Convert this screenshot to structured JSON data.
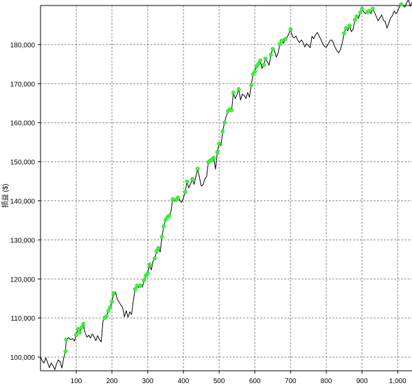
{
  "chart_data": {
    "type": "line",
    "title": "",
    "xlabel": "",
    "ylabel": "损益 ($)",
    "xlim": [
      0,
      1040
    ],
    "ylim": [
      96500,
      190000
    ],
    "x_ticks": [
      100,
      200,
      300,
      400,
      500,
      600,
      700,
      800,
      900,
      1000
    ],
    "x_tick_labels": [
      "100",
      "200",
      "300",
      "400",
      "500",
      "600",
      "700",
      "800",
      "900",
      "1,000"
    ],
    "y_ticks": [
      100000,
      110000,
      120000,
      130000,
      140000,
      150000,
      160000,
      170000,
      180000
    ],
    "y_tick_labels": [
      "100,000",
      "110,000",
      "120,000",
      "130,000",
      "140,000",
      "150,000",
      "160,000",
      "170,000",
      "180,000"
    ],
    "grid": true,
    "legend": "none",
    "colors": {
      "line": "#000000",
      "marker": "#33ff33",
      "grid": "#8c8c8c",
      "axis": "#000000"
    },
    "series": [
      {
        "values": [
          [
            0,
            100000
          ],
          [
            5,
            99000
          ],
          [
            10,
            98500
          ],
          [
            15,
            99800
          ],
          [
            20,
            98500
          ],
          [
            25,
            97300
          ],
          [
            30,
            98500
          ],
          [
            35,
            97800
          ],
          [
            40,
            96800
          ],
          [
            45,
            98300
          ],
          [
            50,
            99300
          ],
          [
            55,
            98800
          ],
          [
            60,
            97200
          ],
          [
            65,
            99800
          ],
          [
            70,
            101500
          ],
          [
            72,
            104500
          ],
          [
            78,
            105000
          ],
          [
            84,
            104500
          ],
          [
            90,
            104700
          ],
          [
            95,
            104100
          ],
          [
            100,
            105700
          ],
          [
            105,
            107200
          ],
          [
            110,
            106300
          ],
          [
            115,
            107500
          ],
          [
            120,
            108500
          ],
          [
            125,
            106200
          ],
          [
            130,
            105100
          ],
          [
            135,
            105600
          ],
          [
            140,
            104900
          ],
          [
            145,
            105900
          ],
          [
            150,
            105200
          ],
          [
            155,
            104200
          ],
          [
            160,
            105500
          ],
          [
            165,
            104500
          ],
          [
            170,
            103900
          ],
          [
            175,
            109200
          ],
          [
            180,
            110100
          ],
          [
            185,
            110500
          ],
          [
            190,
            111900
          ],
          [
            195,
            112800
          ],
          [
            200,
            114200
          ],
          [
            205,
            116300
          ],
          [
            210,
            116700
          ],
          [
            215,
            114800
          ],
          [
            220,
            114100
          ],
          [
            225,
            113300
          ],
          [
            230,
            112700
          ],
          [
            235,
            110300
          ],
          [
            240,
            111900
          ],
          [
            245,
            110200
          ],
          [
            250,
            111600
          ],
          [
            255,
            110900
          ],
          [
            260,
            114700
          ],
          [
            265,
            117400
          ],
          [
            270,
            118300
          ],
          [
            275,
            117800
          ],
          [
            280,
            118300
          ],
          [
            285,
            117900
          ],
          [
            290,
            119700
          ],
          [
            295,
            120900
          ],
          [
            300,
            121400
          ],
          [
            305,
            123700
          ],
          [
            310,
            122300
          ],
          [
            315,
            124600
          ],
          [
            320,
            125300
          ],
          [
            325,
            127100
          ],
          [
            330,
            127900
          ],
          [
            335,
            126900
          ],
          [
            340,
            130800
          ],
          [
            345,
            133500
          ],
          [
            350,
            135100
          ],
          [
            355,
            135800
          ],
          [
            360,
            136200
          ],
          [
            365,
            137200
          ],
          [
            370,
            140400
          ],
          [
            375,
            139900
          ],
          [
            380,
            140300
          ],
          [
            385,
            140800
          ],
          [
            390,
            140200
          ],
          [
            395,
            139600
          ],
          [
            400,
            140700
          ],
          [
            405,
            142300
          ],
          [
            410,
            144900
          ],
          [
            415,
            143300
          ],
          [
            420,
            144300
          ],
          [
            425,
            145600
          ],
          [
            430,
            144200
          ],
          [
            435,
            146300
          ],
          [
            440,
            148200
          ],
          [
            445,
            145900
          ],
          [
            450,
            143800
          ],
          [
            455,
            144100
          ],
          [
            460,
            145600
          ],
          [
            465,
            146200
          ],
          [
            470,
            149900
          ],
          [
            475,
            150300
          ],
          [
            480,
            150600
          ],
          [
            485,
            151000
          ],
          [
            490,
            148100
          ],
          [
            495,
            152500
          ],
          [
            500,
            154600
          ],
          [
            505,
            154100
          ],
          [
            510,
            157800
          ],
          [
            515,
            160000
          ],
          [
            520,
            161700
          ],
          [
            525,
            163000
          ],
          [
            530,
            163400
          ],
          [
            535,
            163200
          ],
          [
            540,
            167700
          ],
          [
            545,
            166200
          ],
          [
            550,
            167200
          ],
          [
            555,
            168600
          ],
          [
            560,
            165800
          ],
          [
            565,
            167300
          ],
          [
            570,
            167000
          ],
          [
            575,
            166200
          ],
          [
            580,
            167700
          ],
          [
            585,
            166500
          ],
          [
            590,
            169700
          ],
          [
            595,
            172400
          ],
          [
            600,
            173100
          ],
          [
            605,
            174400
          ],
          [
            610,
            175100
          ],
          [
            615,
            175900
          ],
          [
            620,
            173900
          ],
          [
            625,
            174800
          ],
          [
            630,
            176400
          ],
          [
            635,
            175600
          ],
          [
            640,
            174700
          ],
          [
            645,
            177400
          ],
          [
            650,
            178900
          ],
          [
            655,
            178400
          ],
          [
            660,
            176800
          ],
          [
            665,
            177700
          ],
          [
            670,
            180100
          ],
          [
            675,
            181000
          ],
          [
            680,
            180300
          ],
          [
            685,
            181400
          ],
          [
            690,
            181800
          ],
          [
            695,
            182700
          ],
          [
            700,
            183900
          ],
          [
            705,
            182100
          ],
          [
            710,
            181700
          ],
          [
            715,
            182200
          ],
          [
            720,
            181100
          ],
          [
            725,
            180500
          ],
          [
            730,
            181200
          ],
          [
            735,
            180600
          ],
          [
            740,
            179400
          ],
          [
            745,
            180200
          ],
          [
            750,
            179800
          ],
          [
            755,
            179200
          ],
          [
            760,
            182100
          ],
          [
            765,
            181500
          ],
          [
            770,
            182500
          ],
          [
            775,
            183100
          ],
          [
            780,
            182200
          ],
          [
            785,
            181300
          ],
          [
            790,
            180200
          ],
          [
            795,
            179500
          ],
          [
            800,
            179300
          ],
          [
            805,
            180100
          ],
          [
            810,
            181000
          ],
          [
            815,
            181200
          ],
          [
            820,
            180400
          ],
          [
            825,
            179200
          ],
          [
            830,
            178400
          ],
          [
            835,
            177900
          ],
          [
            840,
            178800
          ],
          [
            845,
            180600
          ],
          [
            850,
            182900
          ],
          [
            855,
            184200
          ],
          [
            860,
            183500
          ],
          [
            865,
            184900
          ],
          [
            870,
            183300
          ],
          [
            875,
            183900
          ],
          [
            880,
            186300
          ],
          [
            885,
            187200
          ],
          [
            890,
            186700
          ],
          [
            895,
            188200
          ],
          [
            900,
            189200
          ],
          [
            905,
            188300
          ],
          [
            910,
            187900
          ],
          [
            915,
            188300
          ],
          [
            920,
            188600
          ],
          [
            925,
            187900
          ],
          [
            930,
            189200
          ],
          [
            935,
            188200
          ],
          [
            940,
            187200
          ],
          [
            945,
            186100
          ],
          [
            950,
            186800
          ],
          [
            955,
            187600
          ],
          [
            960,
            186300
          ],
          [
            965,
            185800
          ],
          [
            970,
            184200
          ],
          [
            975,
            185500
          ],
          [
            980,
            186800
          ],
          [
            985,
            187400
          ],
          [
            990,
            188600
          ],
          [
            995,
            187900
          ],
          [
            1000,
            188600
          ],
          [
            1005,
            189700
          ],
          [
            1010,
            190300
          ],
          [
            1015,
            190000
          ],
          [
            1020,
            189600
          ],
          [
            1025,
            190700
          ],
          [
            1030,
            191500
          ],
          [
            1035,
            189800
          ],
          [
            1040,
            190800
          ]
        ]
      }
    ],
    "highlight_markers": [
      [
        70,
        101500
      ],
      [
        72,
        104500
      ],
      [
        100,
        105700
      ],
      [
        105,
        107200
      ],
      [
        110,
        106300
      ],
      [
        115,
        107500
      ],
      [
        120,
        108500
      ],
      [
        180,
        110100
      ],
      [
        185,
        110500
      ],
      [
        190,
        111900
      ],
      [
        195,
        112800
      ],
      [
        200,
        114200
      ],
      [
        205,
        116300
      ],
      [
        265,
        117400
      ],
      [
        270,
        118300
      ],
      [
        280,
        118300
      ],
      [
        290,
        119700
      ],
      [
        295,
        120900
      ],
      [
        300,
        121400
      ],
      [
        305,
        123700
      ],
      [
        320,
        125300
      ],
      [
        325,
        127100
      ],
      [
        330,
        127900
      ],
      [
        340,
        130800
      ],
      [
        345,
        133500
      ],
      [
        350,
        135100
      ],
      [
        355,
        135800
      ],
      [
        360,
        136200
      ],
      [
        370,
        140400
      ],
      [
        380,
        140300
      ],
      [
        385,
        140800
      ],
      [
        405,
        142300
      ],
      [
        410,
        144900
      ],
      [
        425,
        145600
      ],
      [
        440,
        148200
      ],
      [
        470,
        149900
      ],
      [
        475,
        150300
      ],
      [
        480,
        150600
      ],
      [
        485,
        151000
      ],
      [
        495,
        152500
      ],
      [
        500,
        154600
      ],
      [
        510,
        157800
      ],
      [
        515,
        160000
      ],
      [
        525,
        163000
      ],
      [
        530,
        163400
      ],
      [
        535,
        163200
      ],
      [
        540,
        167700
      ],
      [
        555,
        168600
      ],
      [
        590,
        169700
      ],
      [
        595,
        172400
      ],
      [
        600,
        173100
      ],
      [
        605,
        174400
      ],
      [
        610,
        175100
      ],
      [
        615,
        175900
      ],
      [
        625,
        174800
      ],
      [
        630,
        176400
      ],
      [
        645,
        177400
      ],
      [
        650,
        178900
      ],
      [
        670,
        180100
      ],
      [
        675,
        181000
      ],
      [
        685,
        181400
      ],
      [
        700,
        183900
      ],
      [
        850,
        182900
      ],
      [
        855,
        184200
      ],
      [
        865,
        184900
      ],
      [
        880,
        186300
      ],
      [
        885,
        187200
      ],
      [
        895,
        188200
      ],
      [
        900,
        189200
      ],
      [
        915,
        188300
      ],
      [
        920,
        188600
      ],
      [
        930,
        189200
      ],
      [
        1010,
        190300
      ]
    ]
  }
}
